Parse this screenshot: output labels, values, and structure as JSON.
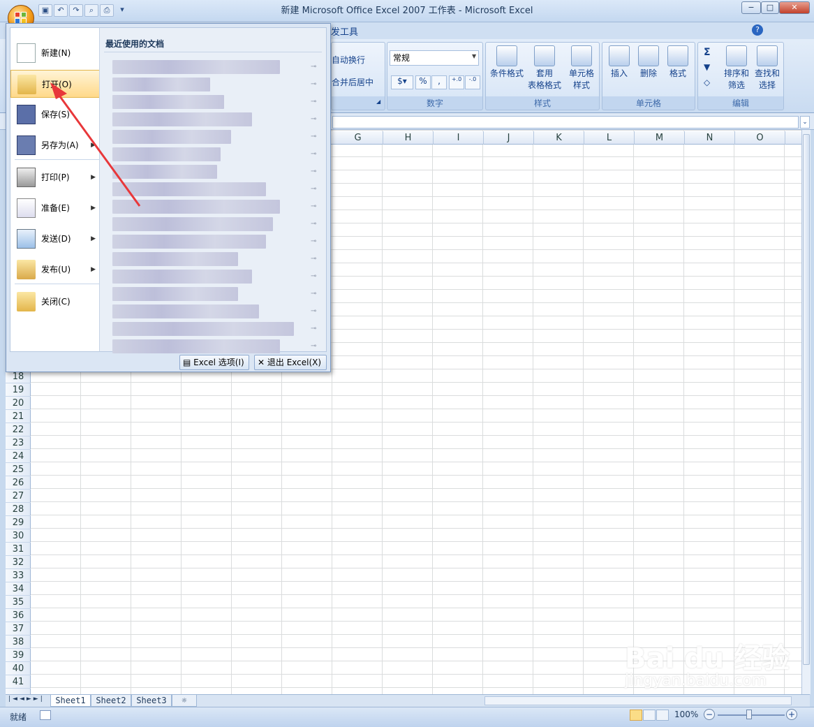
{
  "window": {
    "title": "新建 Microsoft Office Excel 2007 工作表 - Microsoft Excel",
    "min": "−",
    "max": "□",
    "close": "✕"
  },
  "ribbon": {
    "tab_fragment": "发工具",
    "help": "?",
    "alignment": {
      "wrap": "自动换行",
      "merge": "合并后居中"
    },
    "number": {
      "format": "常规",
      "label": "数字",
      "percent": "%",
      "comma": ",",
      "inc": "←.0 .00",
      "dec": ".00 →.0"
    },
    "styles": {
      "cond": "条件格式",
      "table1": "套用",
      "table2": "表格格式",
      "cell1": "单元格",
      "cell2": "样式",
      "label": "样式"
    },
    "cells": {
      "insert": "插入",
      "delete": "删除",
      "format": "格式",
      "label": "单元格"
    },
    "editing": {
      "sort1": "排序和",
      "sort2": "筛选",
      "find1": "查找和",
      "find2": "选择",
      "label": "编辑",
      "sigma": "Σ"
    }
  },
  "columns": [
    "G",
    "H",
    "I",
    "J",
    "K",
    "L",
    "M",
    "N",
    "O"
  ],
  "rows": [
    "18",
    "19",
    "20",
    "21",
    "22",
    "23",
    "24",
    "25",
    "26",
    "27",
    "28",
    "29",
    "30",
    "31",
    "32",
    "33",
    "34",
    "35",
    "36",
    "37",
    "38",
    "39",
    "40",
    "41"
  ],
  "sheets": [
    "Sheet1",
    "Sheet2",
    "Sheet3"
  ],
  "status": {
    "ready": "就绪",
    "zoom": "100%"
  },
  "menu": {
    "recent_title": "最近使用的文档",
    "items": [
      {
        "label": "新建(N)"
      },
      {
        "label": "打开(O)"
      },
      {
        "label": "保存(S)"
      },
      {
        "label": "另存为(A)"
      },
      {
        "label": "打印(P)"
      },
      {
        "label": "准备(E)"
      },
      {
        "label": "发送(D)"
      },
      {
        "label": "发布(U)"
      },
      {
        "label": "关闭(C)"
      }
    ],
    "options_button": "Excel 选项(I)",
    "exit_button": "退出 Excel(X)"
  },
  "watermark": {
    "text": "Bai du 经验",
    "url": "jingyan.baidu.com"
  },
  "colors": {
    "annotation_arrow": "#e8373a"
  }
}
